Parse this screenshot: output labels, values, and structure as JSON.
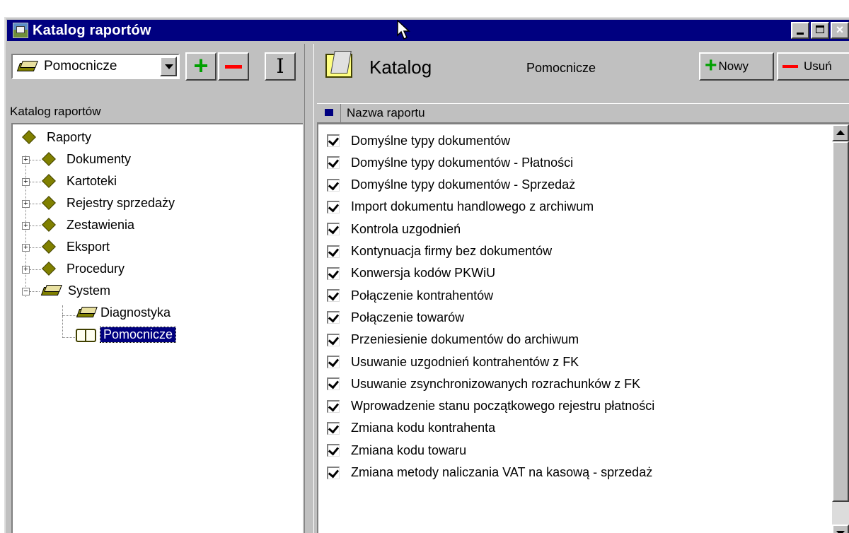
{
  "window": {
    "title": "Katalog raportów"
  },
  "toolbar": {
    "combo_value": "Pomocnicze"
  },
  "tree": {
    "header": "Katalog raportów",
    "nodes": [
      {
        "label": "Raporty",
        "icon": "diamond-icon"
      },
      {
        "label": "Dokumenty",
        "icon": "diamond-icon"
      },
      {
        "label": "Kartoteki",
        "icon": "diamond-icon"
      },
      {
        "label": "Rejestry sprzedaży",
        "icon": "diamond-icon"
      },
      {
        "label": "Zestawienia",
        "icon": "diamond-icon"
      },
      {
        "label": "Eksport",
        "icon": "diamond-icon"
      },
      {
        "label": "Procedury",
        "icon": "diamond-icon"
      },
      {
        "label": "System",
        "icon": "book-icon"
      },
      {
        "label": "Diagnostyka",
        "icon": "book-icon"
      },
      {
        "label": "Pomocnicze",
        "icon": "open-book-icon",
        "selected": true
      }
    ]
  },
  "right": {
    "title": "Katalog",
    "subtitle": "Pomocnicze",
    "new_label": "Nowy",
    "delete_label": "Usuń",
    "column_header": "Nazwa raportu",
    "reports": [
      {
        "name": "Domyślne typy dokumentów",
        "checked": true
      },
      {
        "name": "Domyślne typy dokumentów - Płatności",
        "checked": true
      },
      {
        "name": "Domyślne typy dokumentów - Sprzedaż",
        "checked": true
      },
      {
        "name": "Import dokumentu handlowego z archiwum",
        "checked": true
      },
      {
        "name": "Kontrola uzgodnień",
        "checked": true
      },
      {
        "name": "Kontynuacja firmy bez dokumentów",
        "checked": true
      },
      {
        "name": "Konwersja kodów PKWiU",
        "checked": true
      },
      {
        "name": "Połączenie kontrahentów",
        "checked": true
      },
      {
        "name": "Połączenie towarów",
        "checked": true
      },
      {
        "name": "Przeniesienie dokumentów do archiwum",
        "checked": true
      },
      {
        "name": "Usuwanie uzgodnień kontrahentów z FK",
        "checked": true
      },
      {
        "name": "Usuwanie zsynchronizowanych rozrachunków z FK",
        "checked": true
      },
      {
        "name": "Wprowadzenie stanu początkowego rejestru płatności",
        "checked": true
      },
      {
        "name": "Zmiana kodu kontrahenta",
        "checked": true
      },
      {
        "name": "Zmiana kodu towaru",
        "checked": true
      },
      {
        "name": "Zmiana metody naliczania VAT na kasową - sprzedaż",
        "checked": true
      }
    ]
  }
}
